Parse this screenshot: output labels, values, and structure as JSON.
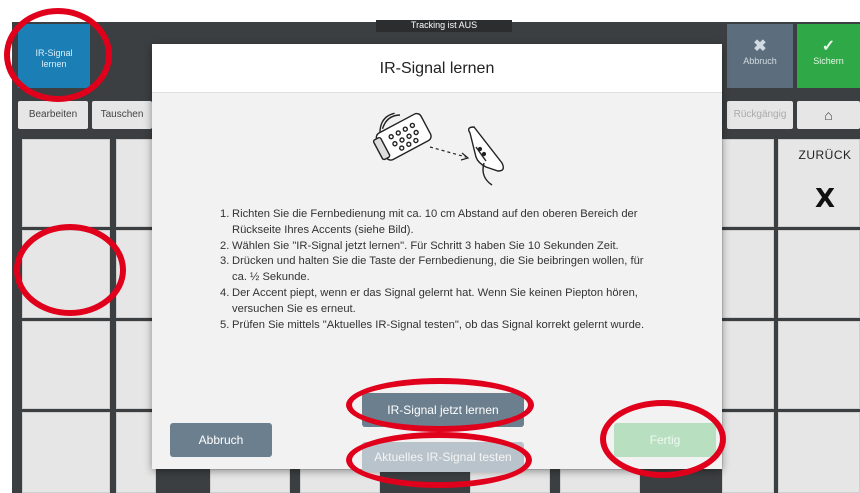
{
  "status_bar": {
    "tracking": "Tracking ist AUS"
  },
  "top_buttons": {
    "ir_signal": "IR-Signal\nlernen",
    "abbruch": "Abbruch",
    "abbruch_icon": "✖",
    "sichern": "Sichern",
    "sichern_icon": "✓"
  },
  "toolbar": {
    "bearbeiten": "Bearbeiten",
    "tauschen": "Tauschen",
    "rueckgaengig": "Rückgängig",
    "home_icon": "⌂"
  },
  "grid": {
    "zurueck_label": "ZURÜCK",
    "zurueck_symbol": "X"
  },
  "dialog": {
    "title": "IR-Signal lernen",
    "illustration_icon": "remote-to-device-icon",
    "steps": [
      "Richten Sie die Fernbedienung mit ca. 10 cm Abstand auf den oberen Bereich der Rückseite Ihres Accents (siehe Bild).",
      "Wählen Sie \"IR-Signal jetzt lernen\". Für Schritt 3 haben Sie 10 Sekunden Zeit.",
      "Drücken und halten Sie die Taste der Fernbedienung, die Sie beibringen wollen, für ca. ½ Sekunde.",
      "Der Accent piept, wenn er das Signal gelernt hat. Wenn Sie keinen Piepton hören, versuchen Sie es erneut.",
      "Prüfen Sie mittels \"Aktuelles IR-Signal testen\", ob das Signal korrekt gelernt wurde."
    ],
    "step_numbers": [
      "1.",
      "2.",
      "3.",
      "4.",
      "5."
    ],
    "buttons": {
      "abbruch": "Abbruch",
      "learn_now": "IR-Signal jetzt lernen",
      "test_current": "Aktuelles IR-Signal testen",
      "fertig": "Fertig"
    }
  },
  "colors": {
    "ir_button": "#1b7fb6",
    "sichern": "#2fa847",
    "dialog_button": "#6c7f8e",
    "annotation": "#e0001b"
  }
}
